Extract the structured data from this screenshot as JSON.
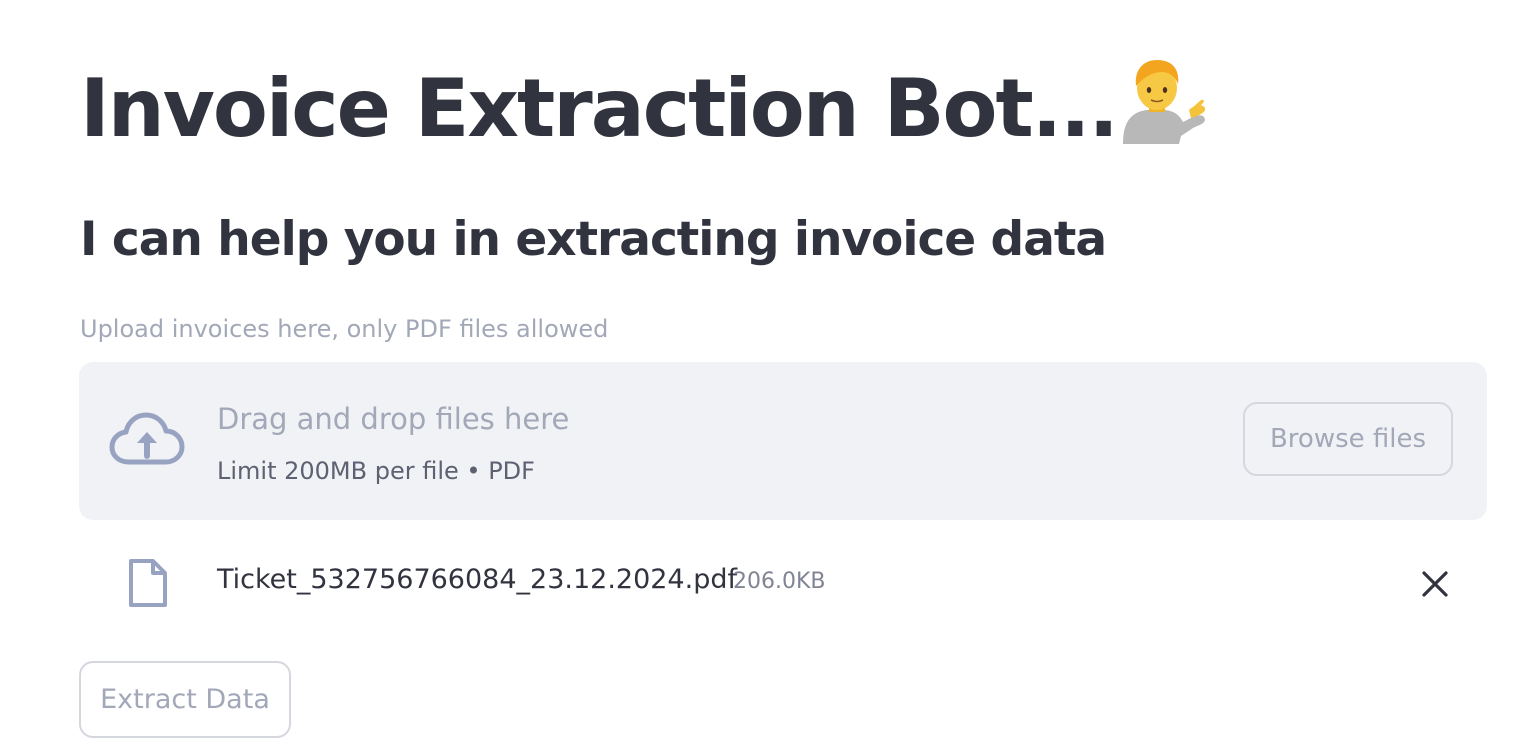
{
  "header": {
    "title": "Invoice Extraction Bot...",
    "title_emoji": "person-tipping-hand-icon",
    "subtitle": "I can help you in extracting invoice data"
  },
  "uploader": {
    "label": "Upload invoices here, only PDF files allowed",
    "dropzone_title": "Drag and drop files here",
    "dropzone_limit": "Limit 200MB per file • PDF",
    "browse_label": "Browse files",
    "icon": "cloud-upload-icon"
  },
  "uploaded_file": {
    "name": "Ticket_532756766084_23.12.2024.pdf",
    "size": "206.0KB",
    "icon": "file-icon",
    "remove_icon": "close-icon"
  },
  "actions": {
    "extract_label": "Extract Data"
  },
  "colors": {
    "text": "#31333f",
    "muted": "#a3a8b8",
    "dropzone_bg": "#f0f2f6",
    "icon": "#98a3c1",
    "border": "#d5d7de"
  }
}
